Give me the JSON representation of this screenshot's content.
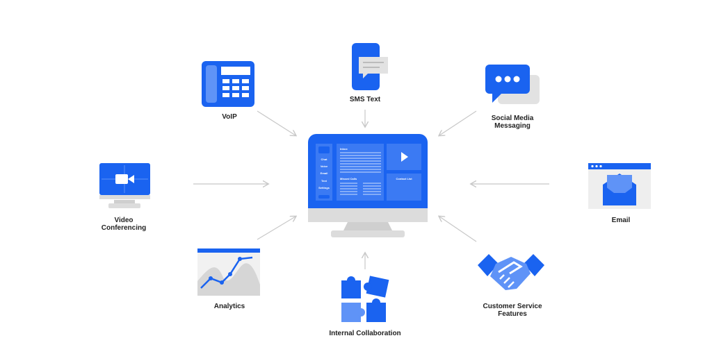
{
  "colors": {
    "brand_blue": "#1a63f0",
    "light_blue": "#5f93f7",
    "gray": "#d6d6d6",
    "arrow": "#c8c8c8"
  },
  "center": {
    "sidebar": [
      "Chat",
      "Voice",
      "Email",
      "Text",
      "Settings"
    ],
    "inbox": "Inbox",
    "missed_calls": "Missed Calls",
    "contact_list": "Contact List"
  },
  "nodes": {
    "voip": "VoIP",
    "sms": "SMS Text",
    "social": "Social Media Messaging",
    "video": "Video Conferencing",
    "email": "Email",
    "analytics": "Analytics",
    "collab": "Internal Collaboration",
    "customer": "Customer Service Features"
  }
}
